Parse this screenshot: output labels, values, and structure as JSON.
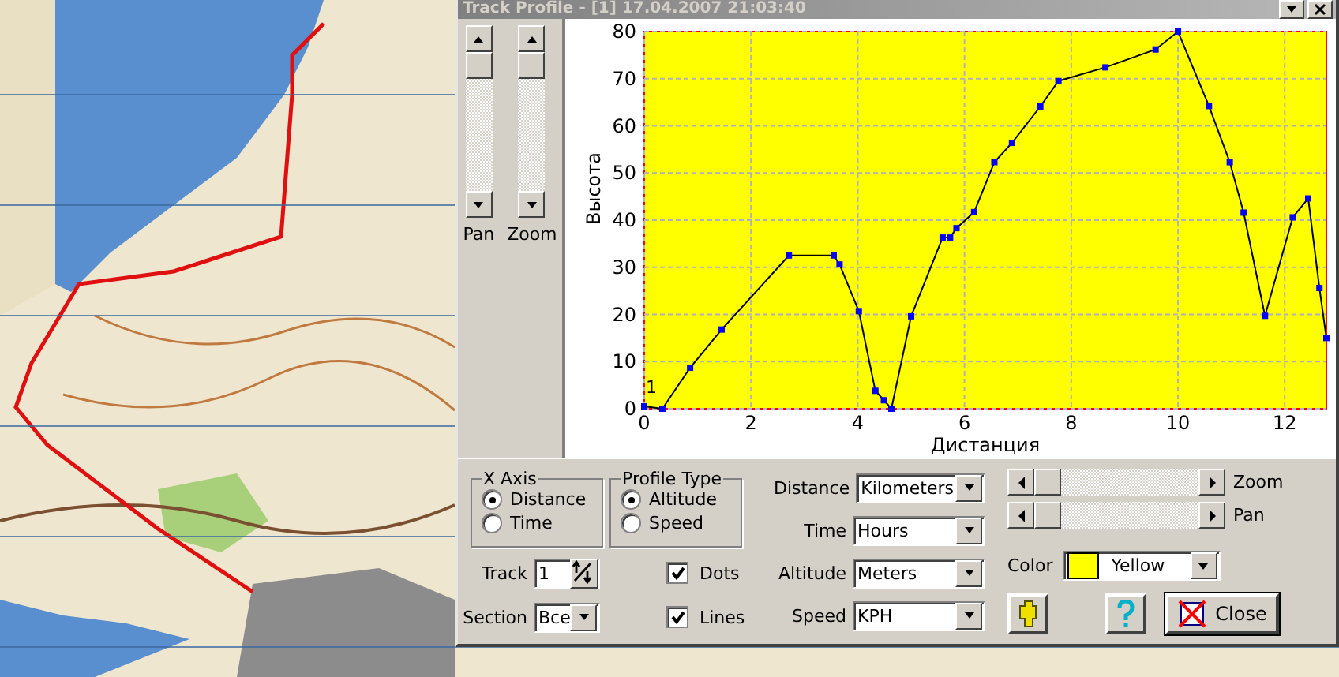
{
  "window": {
    "title": "Track Profile - [1] 17.04.2007 21:03:40"
  },
  "side_scrollbars": [
    {
      "label": "Pan"
    },
    {
      "label": "Zoom"
    }
  ],
  "chart_data": {
    "type": "line",
    "xlabel": "Дистанция",
    "ylabel": "Высота",
    "xlim": [
      0,
      12.78
    ],
    "ylim": [
      0,
      80
    ],
    "xticks": [
      0,
      2,
      4,
      6,
      8,
      10,
      12
    ],
    "yticks": [
      0,
      10,
      20,
      30,
      40,
      50,
      60,
      70,
      80
    ],
    "x": [
      0,
      0.34,
      0.86,
      1.45,
      2.71,
      3.55,
      3.66,
      4.02,
      4.33,
      4.49,
      4.63,
      5.0,
      5.59,
      5.73,
      5.85,
      6.18,
      6.56,
      6.89,
      7.42,
      7.76,
      8.64,
      9.58,
      10.0,
      10.58,
      10.97,
      11.23,
      11.63,
      12.15,
      12.44,
      12.65,
      12.78
    ],
    "grid": true,
    "series": [
      {
        "color": "#000000",
        "marker": "square",
        "values": [
          0.5,
          0,
          8.7,
          16.8,
          32.5,
          32.5,
          30.6,
          20.7,
          3.8,
          1.8,
          0,
          19.6,
          36.3,
          36.3,
          38.3,
          41.7,
          52.3,
          56.4,
          64.1,
          69.5,
          72.4,
          76.2,
          80,
          64.2,
          52.3,
          41.6,
          19.7,
          40.6,
          44.6,
          25.6,
          15
        ]
      }
    ]
  },
  "track_label": "1",
  "x_axis": {
    "title": "X Axis",
    "options": [
      {
        "label": "Distance",
        "selected": true
      },
      {
        "label": "Time",
        "selected": false
      }
    ]
  },
  "profile_type": {
    "title": "Profile Type",
    "options": [
      {
        "label": "Altitude",
        "selected": true
      },
      {
        "label": "Speed",
        "selected": false
      }
    ]
  },
  "track": {
    "label": "Track",
    "value": "1"
  },
  "section": {
    "label": "Section",
    "value": "Все"
  },
  "checkboxes": [
    {
      "label": "Dots",
      "checked": true
    },
    {
      "label": "Lines",
      "checked": true
    }
  ],
  "units": [
    {
      "label": "Distance",
      "value": "Kilometers"
    },
    {
      "label": "Time",
      "value": "Hours"
    },
    {
      "label": "Altitude",
      "value": "Meters"
    },
    {
      "label": "Speed",
      "value": "KPH"
    }
  ],
  "sliders": [
    {
      "label": "Zoom"
    },
    {
      "label": "Pan"
    }
  ],
  "color": {
    "label": "Color",
    "value": "Yellow",
    "color": "#ffff00"
  },
  "close_button": {
    "label": "Close"
  }
}
